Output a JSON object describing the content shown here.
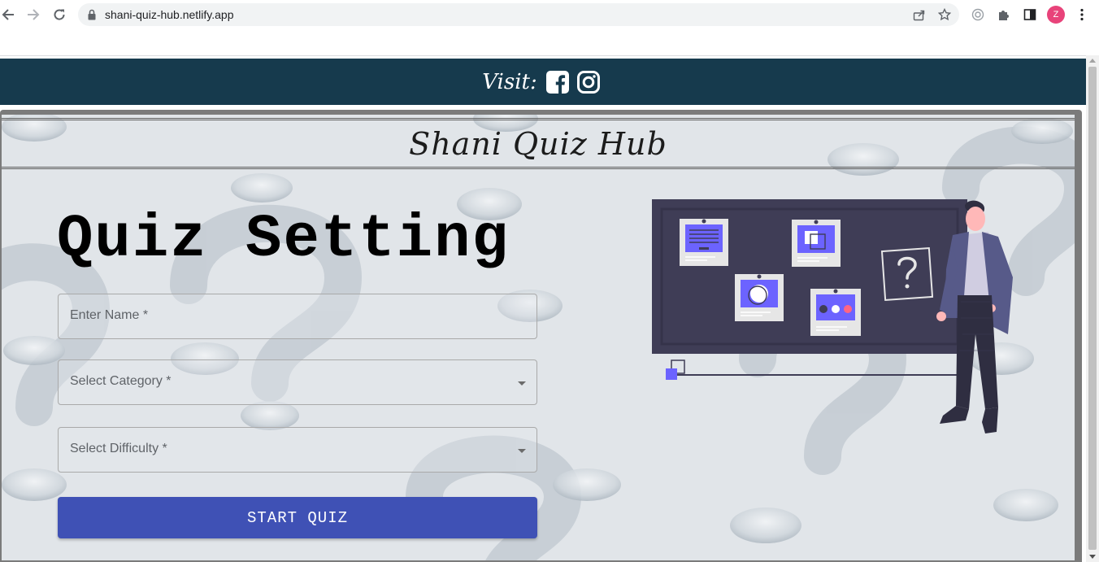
{
  "browser": {
    "url": "shani-quiz-hub.netlify.app",
    "profile_initial": "Z",
    "icons": [
      "back-icon",
      "forward-icon",
      "reload-icon",
      "lock-icon",
      "share-icon",
      "bookmark-star-icon",
      "extension-icon",
      "puzzle-icon",
      "side-panel-icon",
      "menu-icon"
    ]
  },
  "banner": {
    "visit_label": "Visit:",
    "links": [
      "facebook-icon",
      "instagram-icon"
    ],
    "background": "#163a4d"
  },
  "header": {
    "brand": "Shani Quiz Hub"
  },
  "form": {
    "title": "Quiz Setting",
    "name_label": "Enter Name *",
    "category_label": "Select Category *",
    "difficulty_label": "Select Difficulty *",
    "submit_label": "START QUIZ",
    "accent": "#3f51b5"
  },
  "illustration": {
    "icon": "presentation-board-illustration",
    "accent": "#6c63ff",
    "board_color": "#3f3d56"
  }
}
